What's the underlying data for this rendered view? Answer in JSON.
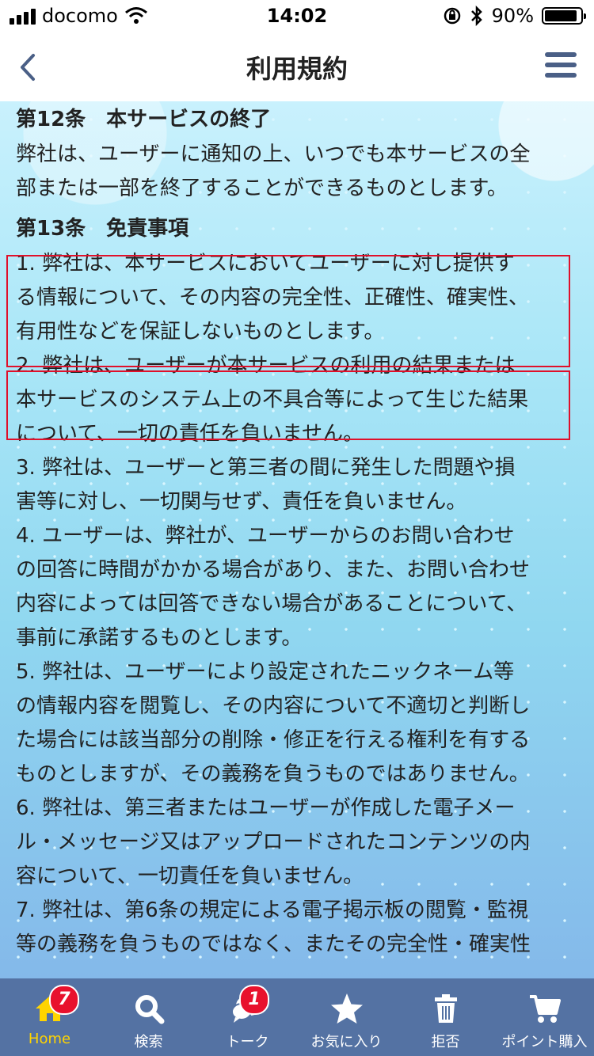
{
  "status_bar": {
    "carrier": "docomo",
    "time": "14:02",
    "battery": "90%",
    "battery_fraction": 0.9
  },
  "nav": {
    "title": "利用規約"
  },
  "article": {
    "lines": [
      {
        "t": "h",
        "text": "第12条　本サービスの終了"
      },
      {
        "t": "p",
        "text": "弊社は、ユーザーに通知の上、いつでも本サービスの全"
      },
      {
        "t": "p",
        "text": "部または一部を終了することができるものとします。"
      },
      {
        "t": "h",
        "text": "第13条　免責事項"
      },
      {
        "t": "p",
        "text": "1.  弊社は、本サービスにおいてユーザーに対し提供す"
      },
      {
        "t": "p",
        "text": "る情報について、その内容の完全性、正確性、確実性、"
      },
      {
        "t": "p",
        "text": "有用性などを保証しないものとします。"
      },
      {
        "t": "p",
        "text": "2.  弊社は、ユーザーが本サービスの利用の結果または"
      },
      {
        "t": "p",
        "text": "本サービスのシステム上の不具合等によって生じた結果"
      },
      {
        "t": "p",
        "text": "について、一切の責任を負いません。"
      },
      {
        "t": "p",
        "text": "3.  弊社は、ユーザーと第三者の間に発生した問題や損"
      },
      {
        "t": "p",
        "text": "害等に対し、一切関与せず、責任を負いません。"
      },
      {
        "t": "p",
        "text": "4.  ユーザーは、弊社が、ユーザーからのお問い合わせ"
      },
      {
        "t": "p",
        "text": "の回答に時間がかかる場合があり、また、お問い合わせ"
      },
      {
        "t": "p",
        "text": "内容によっては回答できない場合があることについて、"
      },
      {
        "t": "p",
        "text": "事前に承諾するものとします。"
      },
      {
        "t": "p",
        "text": "5.  弊社は、ユーザーにより設定されたニックネーム等"
      },
      {
        "t": "p",
        "text": "の情報内容を閲覧し、その内容について不適切と判断し"
      },
      {
        "t": "p",
        "text": "た場合には該当部分の削除・修正を行える権利を有する"
      },
      {
        "t": "p",
        "text": "ものとしますが、その義務を負うものではありません。"
      },
      {
        "t": "p",
        "text": "6.  弊社は、第三者またはユーザーが作成した電子メー"
      },
      {
        "t": "p",
        "text": "ル・メッセージ又はアップロードされたコンテンツの内"
      },
      {
        "t": "p",
        "text": "容について、一切責任を負いません。"
      },
      {
        "t": "p",
        "text": "7.  弊社は、第6条の規定による電子掲示板の閲覧・監視"
      },
      {
        "t": "p",
        "text": "等の義務を負うものではなく、またその完全性・確実性"
      }
    ]
  },
  "tabs": [
    {
      "label": "Home",
      "icon": "home-icon",
      "badge": "7",
      "active": true
    },
    {
      "label": "検索",
      "icon": "search-icon",
      "badge": "",
      "active": false
    },
    {
      "label": "トーク",
      "icon": "chat-bubble-icon",
      "badge": "1",
      "active": false
    },
    {
      "label": "お気に入り",
      "icon": "star-icon",
      "badge": "",
      "active": false
    },
    {
      "label": "拒否",
      "icon": "trash-icon",
      "badge": "",
      "active": false
    },
    {
      "label": "ポイント購入",
      "icon": "cart-icon",
      "badge": "",
      "active": false
    }
  ],
  "colors": {
    "tab_bar": "#5472a3",
    "active_tab": "#ffd400",
    "badge": "#e8112d",
    "highlight": "#e0102a",
    "nav_icon": "#4a5f86"
  }
}
